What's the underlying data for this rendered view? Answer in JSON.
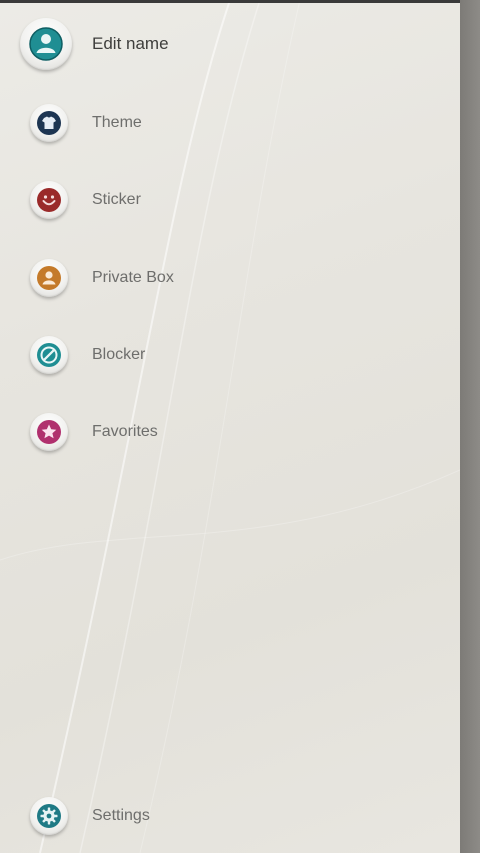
{
  "menu": {
    "items": [
      {
        "label": "Edit name",
        "icon": "person-icon",
        "color": "#1f8e93"
      },
      {
        "label": "Theme",
        "icon": "shirt-icon",
        "color": "#1d3552"
      },
      {
        "label": "Sticker",
        "icon": "smiley-icon",
        "color": "#9a2a2a"
      },
      {
        "label": "Private Box",
        "icon": "lock-person-icon",
        "color": "#c47a2a"
      },
      {
        "label": "Blocker",
        "icon": "block-icon",
        "color": "#1f8e93"
      },
      {
        "label": "Favorites",
        "icon": "star-icon",
        "color": "#b0306e"
      }
    ],
    "settings": {
      "label": "Settings",
      "icon": "gear-icon",
      "color": "#1f7a85"
    }
  }
}
